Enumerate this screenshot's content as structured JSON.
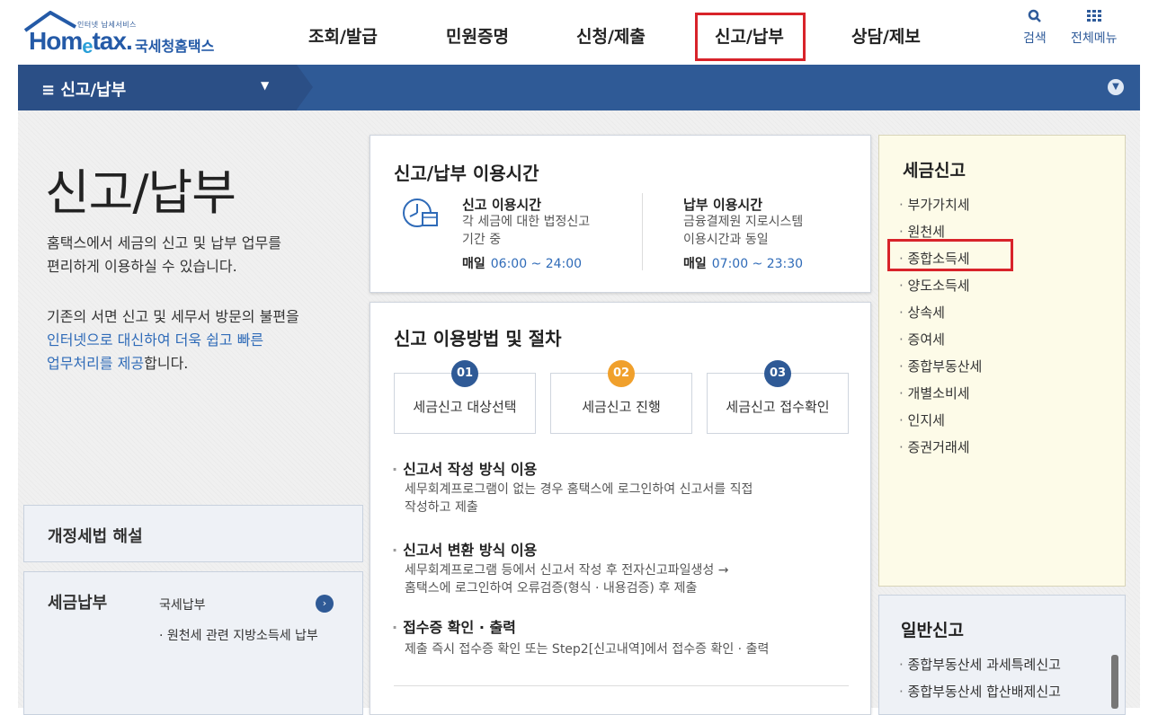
{
  "header": {
    "logo_tagline": "인터넷 납세서비스",
    "logo_text_a": "Hom",
    "logo_text_e": "e",
    "logo_text_b": "tax.",
    "logo_kor": "국세청홈택스",
    "nav": [
      "조회/발급",
      "민원증명",
      "신청/제출",
      "신고/납부",
      "상담/제보"
    ],
    "search_label": "검색",
    "menu_label": "전체메뉴"
  },
  "bar": {
    "label": "≡  신고/납부"
  },
  "hero": {
    "title": "신고/납부",
    "p1_line1": "홈택스에서 세금의 신고 및 납부 업무를",
    "p1_line2": "편리하게 이용하실 수 있습니다.",
    "p2_line1": "기존의 서면 신고 및 세무서 방문의 불편을",
    "p2_line2": "인터넷으로 대신하여 더욱 쉽고 빠른",
    "p2_line3a": "업무처리를 제공",
    "p2_line3b": "합니다."
  },
  "left_panels": {
    "reform_title": "개정세법 해설",
    "pay_title": "세금납부",
    "pay_item1": "국세납부",
    "pay_item2": "· 원천세 관련 지방소득세 납부"
  },
  "usage_time": {
    "title": "신고/납부 이용시간",
    "report_title": "신고 이용시간",
    "report_desc1": "각 세금에 대한 법정신고",
    "report_desc2": "기간 중",
    "report_day": "매일",
    "report_time": "06:00 ~ 24:00",
    "pay_title": "납부 이용시간",
    "pay_desc1": "금융결제원 지로시스템",
    "pay_desc2": "이용시간과 동일",
    "pay_day": "매일",
    "pay_time": "07:00 ~ 23:30"
  },
  "procedure": {
    "title": "신고 이용방법 및 절차",
    "steps": [
      {
        "num": "01",
        "label": "세금신고 대상선택",
        "color": "#2f5a96"
      },
      {
        "num": "02",
        "label": "세금신고 진행",
        "color": "#f0a02c"
      },
      {
        "num": "03",
        "label": "세금신고 접수확인",
        "color": "#2f5a96"
      }
    ],
    "m1_title": "신고서 작성 방식 이용",
    "m1_desc1": "세무회계프로그램이 없는 경우 홈택스에 로그인하여 신고서를 직접",
    "m1_desc2": "작성하고 제출",
    "m2_title": "신고서 변환 방식 이용",
    "m2_desc1": "세무회계프로그램 등에서 신고서 작성 후 전자신고파일생성 →",
    "m2_desc2": "홈택스에 로그인하여 오류검증(형식 · 내용검증) 후 제출",
    "m3_title": "접수증 확인 · 출력",
    "m3_desc1": "제출 즉시 접수증 확인 또는 Step2[신고내역]에서 접수증 확인 · 출력"
  },
  "tax_report": {
    "title": "세금신고",
    "items": [
      "부가가치세",
      "원천세",
      "종합소득세",
      "양도소득세",
      "상속세",
      "증여세",
      "종합부동산세",
      "개별소비세",
      "인지세",
      "증권거래세"
    ]
  },
  "general_report": {
    "title": "일반신고",
    "items": [
      "종합부동산세 과세특례신고",
      "종합부동산세 합산배제신고"
    ]
  }
}
